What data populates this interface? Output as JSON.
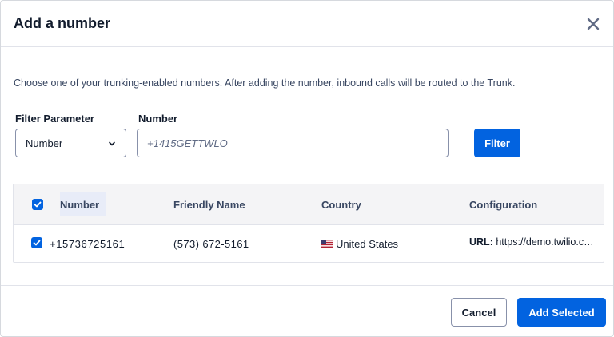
{
  "modal": {
    "title": "Add a number",
    "description": "Choose one of your trunking-enabled numbers. After adding the number, inbound calls will be routed to the Trunk."
  },
  "filters": {
    "parameter_label": "Filter Parameter",
    "parameter_value": "Number",
    "number_label": "Number",
    "number_placeholder": "+1415GETTWLO",
    "filter_button": "Filter"
  },
  "table": {
    "columns": [
      "Number",
      "Friendly Name",
      "Country",
      "Configuration"
    ],
    "header_checked": true,
    "rows": [
      {
        "checked": true,
        "number": "+15736725161",
        "friendly_name": "(573) 672-5161",
        "country": "United States",
        "flag_icon": "us-flag-icon",
        "config_label": "URL:",
        "config_value": "https://demo.twilio.com/welcome/voice/"
      }
    ]
  },
  "footer": {
    "cancel_label": "Cancel",
    "add_label": "Add Selected"
  },
  "colors": {
    "primary": "#0263e0",
    "text": "#121c2d",
    "border": "#8891aa"
  }
}
